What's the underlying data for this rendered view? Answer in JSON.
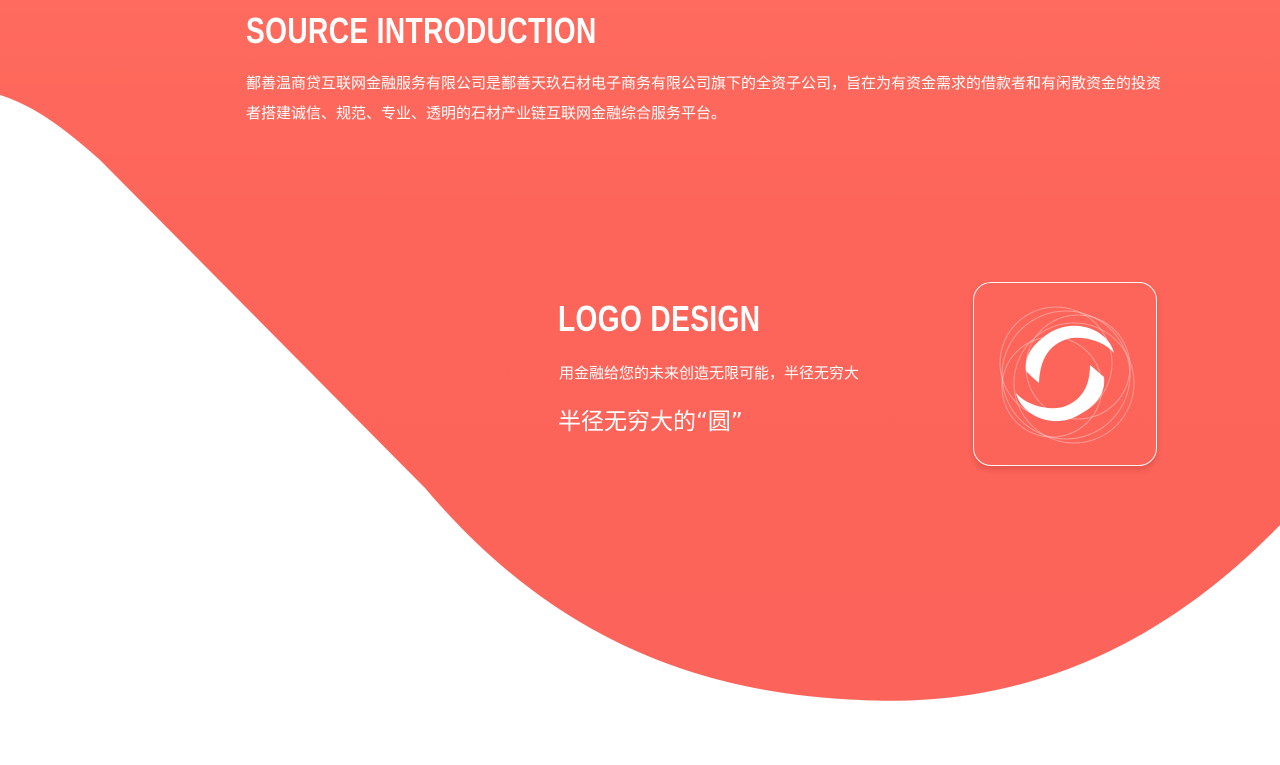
{
  "colors": {
    "accent": "#FD655A",
    "text_on_accent": "#FFFFFF",
    "background": "#FFFFFF"
  },
  "source_section": {
    "title": "SOURCE INTRODUCTION",
    "body": "鄯善温商贷互联网金融服务有限公司是鄯善天玖石材电子商务有限公司旗下的全资子公司，旨在为有资金需求的借款者和有闲散资金的投资者搭建诚信、规范、专业、透明的石材产业链互联网金融综合服务平台。"
  },
  "logo_section": {
    "title": "LOGO DESIGN",
    "tagline": "用金融给您的未来创造无限可能，半径无穷大",
    "slogan": "半径无穷大的“圆”",
    "icon": "circular-swirl-logo-icon"
  }
}
